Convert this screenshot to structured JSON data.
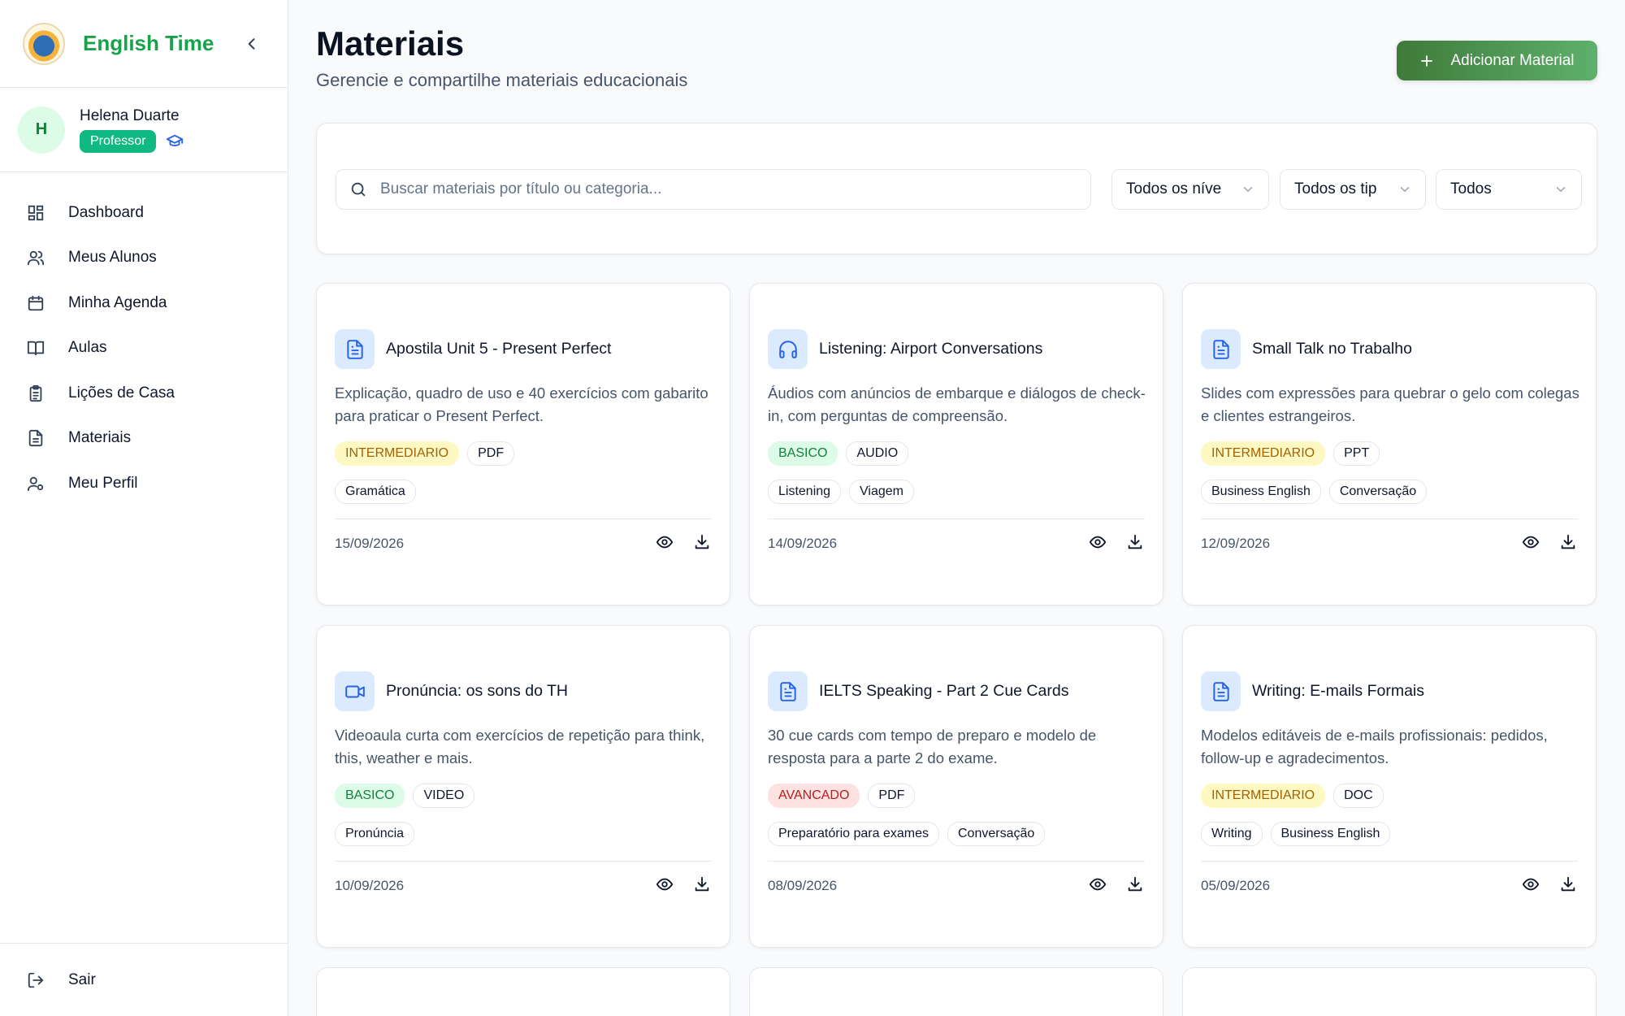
{
  "app": {
    "name": "English Time",
    "logo_icon": "logo-badge-icon"
  },
  "user": {
    "initial": "H",
    "name": "Helena Duarte",
    "role": "Professor"
  },
  "nav": [
    {
      "label": "Dashboard",
      "icon": "dashboard-icon"
    },
    {
      "label": "Meus Alunos",
      "icon": "users-icon"
    },
    {
      "label": "Minha Agenda",
      "icon": "calendar-icon"
    },
    {
      "label": "Aulas",
      "icon": "book-icon"
    },
    {
      "label": "Lições de Casa",
      "icon": "clipboard-icon"
    },
    {
      "label": "Materiais",
      "icon": "file-icon"
    },
    {
      "label": "Meu Perfil",
      "icon": "user-settings-icon"
    }
  ],
  "logout": "Sair",
  "page": {
    "title": "Materiais",
    "subtitle": "Gerencie e compartilhe materiais educacionais",
    "add_button": "Adicionar Material"
  },
  "filters": {
    "search_placeholder": "Buscar materiais por título ou categoria...",
    "level": "Todos os níve",
    "type": "Todos os tip",
    "other": "Todos"
  },
  "colors": {
    "brand": "#16a34a",
    "accent": "#10b981",
    "icon_blue": "#2563eb"
  },
  "materials": [
    {
      "title": "Apostila Unit 5 - Present Perfect",
      "icon": "document-icon",
      "desc": "Explicação, quadro de uso e 40 exercícios com gabarito para praticar o Present Perfect.",
      "level": "INTERMEDIARIO",
      "type": "PDF",
      "tags": [
        "Gramática"
      ],
      "date": "15/09/2026"
    },
    {
      "title": "Listening: Airport Conversations",
      "icon": "headphones-icon",
      "desc": "Áudios com anúncios de embarque e diálogos de check-in, com perguntas de compreensão.",
      "level": "BASICO",
      "type": "AUDIO",
      "tags": [
        "Listening",
        "Viagem"
      ],
      "date": "14/09/2026"
    },
    {
      "title": "Small Talk no Trabalho",
      "icon": "document-icon",
      "desc": "Slides com expressões para quebrar o gelo com colegas e clientes estrangeiros.",
      "level": "INTERMEDIARIO",
      "type": "PPT",
      "tags": [
        "Business English",
        "Conversação"
      ],
      "date": "12/09/2026"
    },
    {
      "title": "Pronúncia: os sons do TH",
      "icon": "video-icon",
      "desc": "Videoaula curta com exercícios de repetição para think, this, weather e mais.",
      "level": "BASICO",
      "type": "VIDEO",
      "tags": [
        "Pronúncia"
      ],
      "date": "10/09/2026"
    },
    {
      "title": "IELTS Speaking - Part 2 Cue Cards",
      "icon": "document-icon",
      "desc": "30 cue cards com tempo de preparo e modelo de resposta para a parte 2 do exame.",
      "level": "AVANCADO",
      "type": "PDF",
      "tags": [
        "Preparatório para exames",
        "Conversação"
      ],
      "date": "08/09/2026"
    },
    {
      "title": "Writing: E-mails Formais",
      "icon": "document-icon",
      "desc": "Modelos editáveis de e-mails profissionais: pedidos, follow-up e agradecimentos.",
      "level": "INTERMEDIARIO",
      "type": "DOC",
      "tags": [
        "Writing",
        "Business English"
      ],
      "date": "05/09/2026"
    }
  ]
}
